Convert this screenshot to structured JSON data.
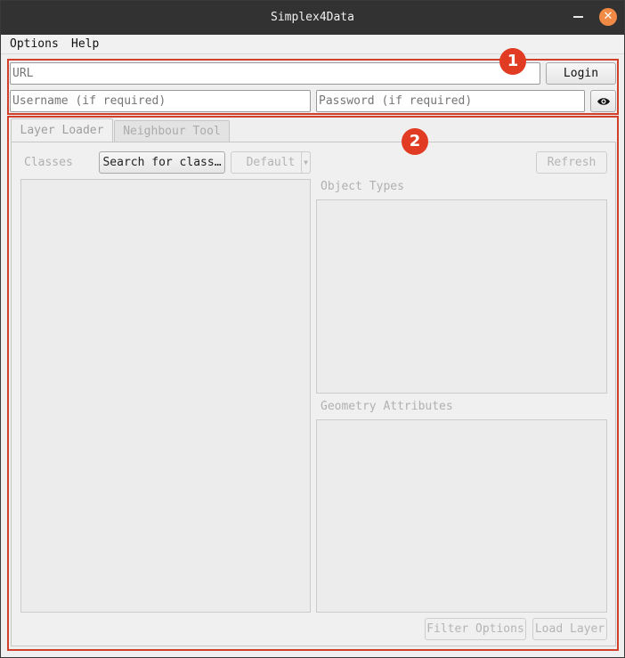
{
  "window": {
    "title": "Simplex4Data"
  },
  "menu": {
    "options": "Options",
    "help": "Help"
  },
  "callouts": {
    "one": "1",
    "two": "2"
  },
  "login": {
    "url_placeholder": "URL",
    "username_placeholder": "Username (if required)",
    "password_placeholder": "Password (if required)",
    "login_label": "Login",
    "reveal_icon": "eye-icon"
  },
  "tabs": [
    {
      "label": "Layer Loader",
      "active": true
    },
    {
      "label": "Neighbour Tool",
      "active": false
    }
  ],
  "layer_loader": {
    "classes_label": "Classes",
    "search_label": "Search for class…",
    "dropdown_value": "Default",
    "refresh_label": "Refresh",
    "object_types_label": "Object Types",
    "geometry_attributes_label": "Geometry Attributes",
    "filter_options_label": "Filter Options",
    "load_layer_label": "Load Layer"
  },
  "colors": {
    "callout_red": "#e23b24",
    "close_orange": "#f08a45",
    "titlebar": "#323232"
  }
}
